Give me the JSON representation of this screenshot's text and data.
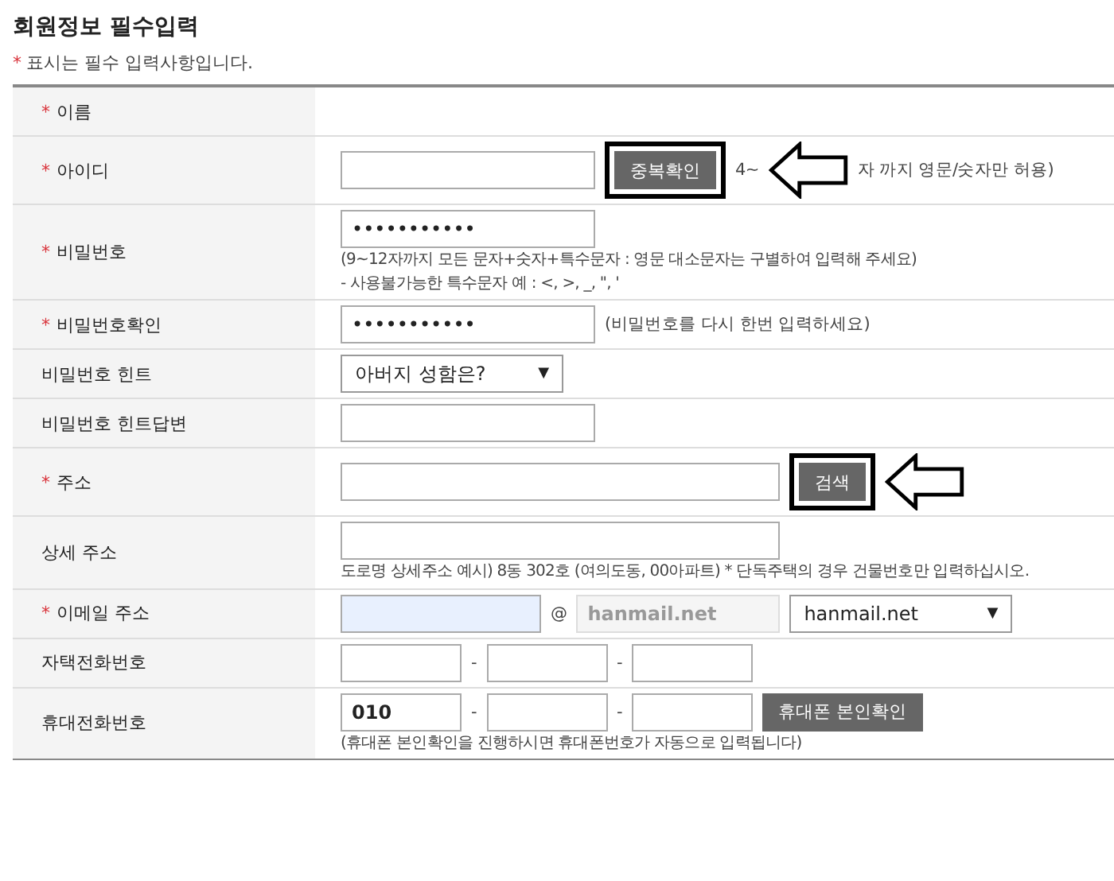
{
  "title": "회원정보 필수입력",
  "required_note": {
    "mark": "*",
    "text": "표시는 필수 입력사항입니다."
  },
  "rows": [
    {
      "label": "이름",
      "required": true,
      "controls": []
    },
    {
      "label": "아이디",
      "required": true,
      "controls": [
        {
          "kind": "input"
        },
        {
          "kind": "button",
          "label": "중복확인",
          "annotated": true
        },
        {
          "kind": "note",
          "text": "4~"
        },
        {
          "kind": "arrow"
        },
        {
          "kind": "note",
          "text": "자 까지 영문/숫자만 허용)"
        }
      ]
    },
    {
      "label": "비밀번호",
      "required": true,
      "controls": [
        {
          "kind": "input",
          "value": "•••••••••••"
        },
        {
          "kind": "note-block",
          "text": "(9~12자까지 모든 문자+숫자+특수문자 : 영문 대소문자는 구별하여 입력해 주세요)"
        },
        {
          "kind": "note-block",
          "text": "- 사용불가능한 특수문자 예 : <, >, _, \", '"
        }
      ]
    },
    {
      "label": "비밀번호확인",
      "required": true,
      "controls": [
        {
          "kind": "input",
          "value": "•••••••••••"
        },
        {
          "kind": "note",
          "text": "(비밀번호를 다시 한번 입력하세요)"
        }
      ]
    },
    {
      "label": "비밀번호 힌트",
      "required": false,
      "controls": [
        {
          "kind": "select",
          "value": "아버지 성함은?",
          "caret": "▼"
        }
      ]
    },
    {
      "label": "비밀번호 힌트답변",
      "required": false,
      "controls": [
        {
          "kind": "input"
        }
      ]
    },
    {
      "label": "주소",
      "required": true,
      "controls": [
        {
          "kind": "wide-input"
        },
        {
          "kind": "button",
          "label": "검색",
          "annotated": true
        },
        {
          "kind": "arrow"
        }
      ]
    },
    {
      "label": "상세 주소",
      "required": false,
      "controls": [
        {
          "kind": "wide-input"
        },
        {
          "kind": "note-block",
          "text": "도로명 상세주소 예시) 8동 302호 (여의도동, 00아파트) * 단독주택의 경우 건물번호만 입력하십시오."
        }
      ]
    },
    {
      "label": "이메일 주소",
      "required": true,
      "controls": [
        {
          "kind": "email-input"
        },
        {
          "kind": "note",
          "text": "@"
        },
        {
          "kind": "disabled-input",
          "value": "hanmail.net"
        },
        {
          "kind": "select",
          "value": "hanmail.net",
          "caret": "▼"
        }
      ]
    },
    {
      "label": "자택전화번호",
      "required": false,
      "controls": [
        {
          "kind": "small-input"
        },
        {
          "kind": "note",
          "text": "-"
        },
        {
          "kind": "small-input"
        },
        {
          "kind": "note",
          "text": "-"
        },
        {
          "kind": "small-input"
        }
      ]
    },
    {
      "label": "휴대전화번호",
      "required": false,
      "controls": [
        {
          "kind": "small-input",
          "value": "010"
        },
        {
          "kind": "note",
          "text": "-"
        },
        {
          "kind": "small-input"
        },
        {
          "kind": "note",
          "text": "-"
        },
        {
          "kind": "small-input"
        },
        {
          "kind": "button",
          "label": "휴대폰 본인확인",
          "annotated": false
        },
        {
          "kind": "note-block",
          "text": "(휴대폰 본인확인을 진행하시면 휴대폰번호가 자동으로 입력됩니다)"
        }
      ]
    }
  ]
}
